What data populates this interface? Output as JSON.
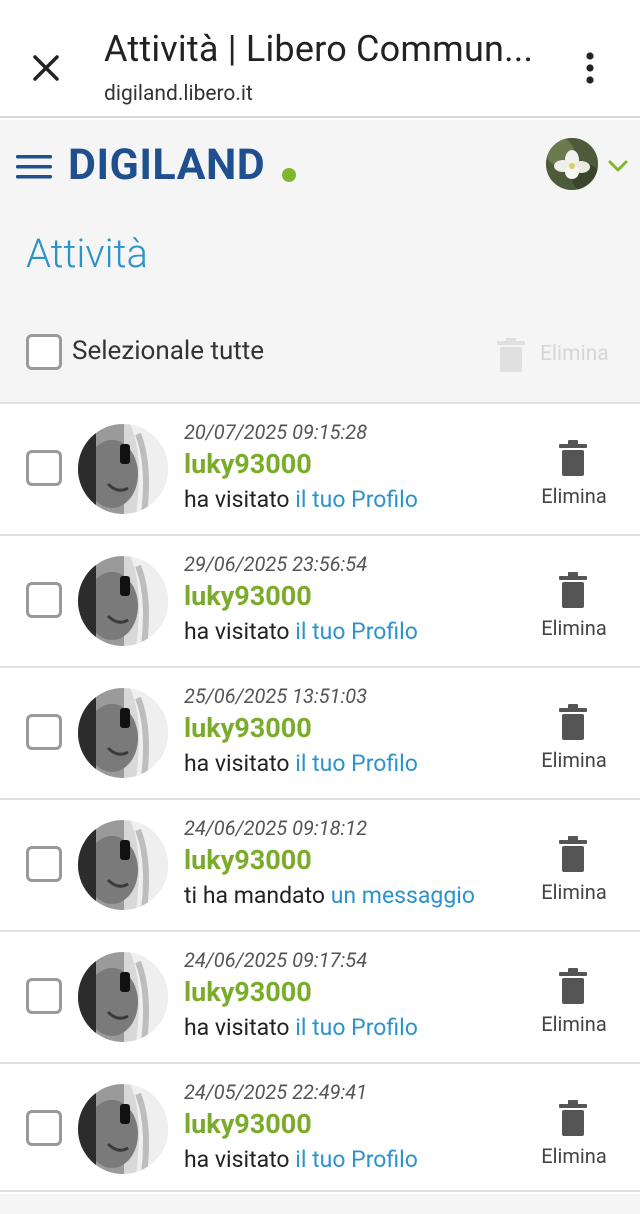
{
  "browser": {
    "title": "Attività | Libero Commun...",
    "url": "digiland.libero.it"
  },
  "header": {
    "logo": "DIGILAND"
  },
  "page": {
    "title": "Attività",
    "select_all_label": "Selezionale tutte",
    "bulk_delete_label": "Elimina"
  },
  "activities": [
    {
      "timestamp": "20/07/2025 09:15:28",
      "user": "luky93000",
      "action": "ha visitato",
      "link": "il tuo Profilo",
      "delete_label": "Elimina"
    },
    {
      "timestamp": "29/06/2025 23:56:54",
      "user": "luky93000",
      "action": "ha visitato",
      "link": "il tuo Profilo",
      "delete_label": "Elimina"
    },
    {
      "timestamp": "25/06/2025 13:51:03",
      "user": "luky93000",
      "action": "ha visitato",
      "link": "il tuo Profilo",
      "delete_label": "Elimina"
    },
    {
      "timestamp": "24/06/2025 09:18:12",
      "user": "luky93000",
      "action": "ti ha mandato",
      "link": "un messaggio",
      "delete_label": "Elimina"
    },
    {
      "timestamp": "24/06/2025 09:17:54",
      "user": "luky93000",
      "action": "ha visitato",
      "link": "il tuo Profilo",
      "delete_label": "Elimina"
    },
    {
      "timestamp": "24/05/2025 22:49:41",
      "user": "luky93000",
      "action": "ha visitato",
      "link": "il tuo Profilo",
      "delete_label": "Elimina"
    }
  ],
  "colors": {
    "accent_blue": "#2b93c9",
    "username_green": "#7aab2a",
    "logo_blue": "#1f4f8f"
  },
  "icons": [
    "close-icon",
    "more-vert-icon",
    "hamburger-icon",
    "chevron-down-icon",
    "trash-icon"
  ]
}
